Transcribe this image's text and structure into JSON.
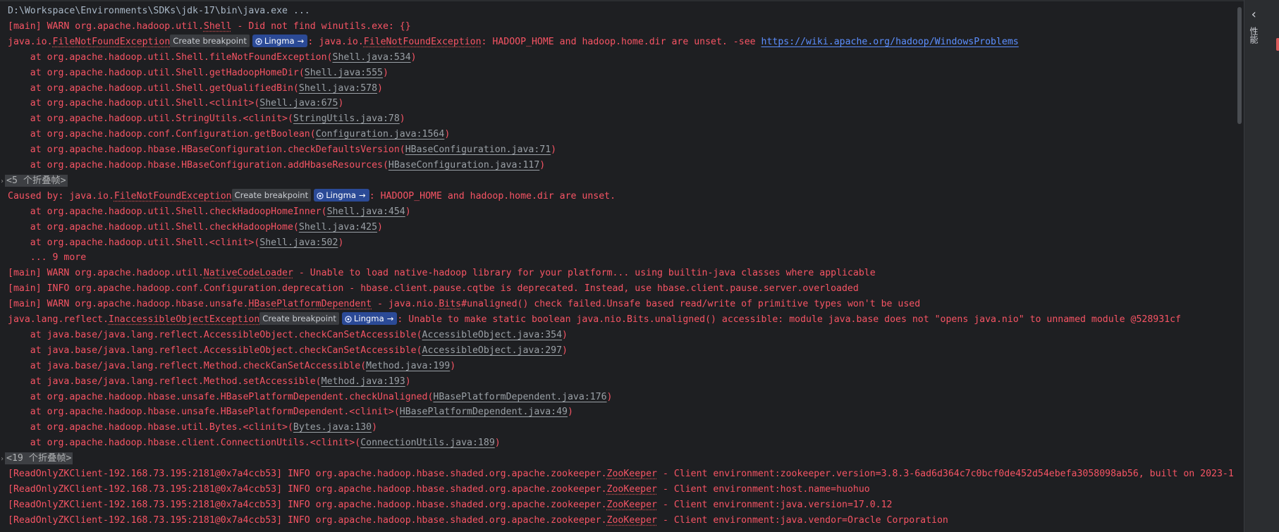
{
  "console": {
    "command": "D:\\Workspace\\Environments\\SDKs\\jdk-17\\bin\\java.exe ...",
    "breakpoint_label": "Create breakpoint",
    "lingma_label": "Lingma",
    "lines": [
      {
        "kind": "cmd"
      },
      {
        "kind": "log",
        "segs": [
          {
            "t": "[main] WARN org.apache.hadoop.util."
          },
          {
            "t": "Shell",
            "s": "u"
          },
          {
            "t": " - Did not find winutils.exe: {}"
          }
        ]
      },
      {
        "kind": "log",
        "segs": [
          {
            "t": "java.io."
          },
          {
            "t": "FileNotFoundException",
            "s": "u"
          },
          {
            "bp": true
          },
          {
            "lg": true
          },
          {
            "t": ": java.io."
          },
          {
            "t": "FileNotFoundException",
            "s": "u"
          },
          {
            "t": ": HADOOP_HOME and hadoop.home.dir are unset. -see "
          },
          {
            "t": "https://wiki.apache.org/hadoop/WindowsProblems",
            "s": "url"
          }
        ]
      },
      {
        "kind": "log",
        "segs": [
          {
            "t": "    at org.apache.hadoop.util.Shell.fileNotFoundException("
          },
          {
            "t": "Shell.java:534",
            "s": "lnk"
          },
          {
            "t": ")"
          }
        ]
      },
      {
        "kind": "log",
        "segs": [
          {
            "t": "    at org.apache.hadoop.util.Shell.getHadoopHomeDir("
          },
          {
            "t": "Shell.java:555",
            "s": "lnk"
          },
          {
            "t": ")"
          }
        ]
      },
      {
        "kind": "log",
        "segs": [
          {
            "t": "    at org.apache.hadoop.util.Shell.getQualifiedBin("
          },
          {
            "t": "Shell.java:578",
            "s": "lnk"
          },
          {
            "t": ")"
          }
        ]
      },
      {
        "kind": "log",
        "segs": [
          {
            "t": "    at org.apache.hadoop.util.Shell.<clinit>("
          },
          {
            "t": "Shell.java:675",
            "s": "lnk"
          },
          {
            "t": ")"
          }
        ]
      },
      {
        "kind": "log",
        "segs": [
          {
            "t": "    at org.apache.hadoop.util.StringUtils.<clinit>("
          },
          {
            "t": "StringUtils.java:78",
            "s": "lnk"
          },
          {
            "t": ")"
          }
        ]
      },
      {
        "kind": "log",
        "segs": [
          {
            "t": "    at org.apache.hadoop.conf.Configuration.getBoolean("
          },
          {
            "t": "Configuration.java:1564",
            "s": "lnk"
          },
          {
            "t": ")"
          }
        ]
      },
      {
        "kind": "log",
        "segs": [
          {
            "t": "    at org.apache.hadoop.hbase.HBaseConfiguration.checkDefaultsVersion("
          },
          {
            "t": "HBaseConfiguration.java:71",
            "s": "lnk"
          },
          {
            "t": ")"
          }
        ]
      },
      {
        "kind": "log",
        "segs": [
          {
            "t": "    at org.apache.hadoop.hbase.HBaseConfiguration.addHbaseResources("
          },
          {
            "t": "HBaseConfiguration.java:117",
            "s": "lnk"
          },
          {
            "t": ")"
          }
        ]
      },
      {
        "kind": "fold",
        "label": "<5 个折叠帧>"
      },
      {
        "kind": "log",
        "segs": [
          {
            "t": "Caused by: java.io."
          },
          {
            "t": "FileNotFoundException",
            "s": "u"
          },
          {
            "bp": true
          },
          {
            "lg": true
          },
          {
            "t": ": HADOOP_HOME and hadoop.home.dir are unset."
          }
        ]
      },
      {
        "kind": "log",
        "segs": [
          {
            "t": "    at org.apache.hadoop.util.Shell.checkHadoopHomeInner("
          },
          {
            "t": "Shell.java:454",
            "s": "lnk"
          },
          {
            "t": ")"
          }
        ]
      },
      {
        "kind": "log",
        "segs": [
          {
            "t": "    at org.apache.hadoop.util.Shell.checkHadoopHome("
          },
          {
            "t": "Shell.java:425",
            "s": "lnk"
          },
          {
            "t": ")"
          }
        ]
      },
      {
        "kind": "log",
        "segs": [
          {
            "t": "    at org.apache.hadoop.util.Shell.<clinit>("
          },
          {
            "t": "Shell.java:502",
            "s": "lnk"
          },
          {
            "t": ")"
          }
        ]
      },
      {
        "kind": "log",
        "segs": [
          {
            "t": "    ... 9 more"
          }
        ]
      },
      {
        "kind": "log",
        "segs": [
          {
            "t": "[main] WARN org.apache.hadoop.util."
          },
          {
            "t": "NativeCodeLoader",
            "s": "u"
          },
          {
            "t": " - Unable to load native-hadoop library for your platform... using builtin-java classes where applicable"
          }
        ]
      },
      {
        "kind": "log",
        "segs": [
          {
            "t": "[main] INFO org.apache.hadoop.conf.Configuration.deprecation - hbase.client.pause.cqtbe is deprecated. Instead, use hbase.client.pause.server.overloaded"
          }
        ]
      },
      {
        "kind": "log",
        "segs": [
          {
            "t": "[main] WARN org.apache.hadoop.hbase.unsafe."
          },
          {
            "t": "HBasePlatformDependent",
            "s": "u"
          },
          {
            "t": " - java.nio."
          },
          {
            "t": "Bits",
            "s": "u"
          },
          {
            "t": "#unaligned() check failed.Unsafe based read/write of primitive types won't be used"
          }
        ]
      },
      {
        "kind": "log",
        "segs": [
          {
            "t": "java.lang.reflect."
          },
          {
            "t": "InaccessibleObjectException",
            "s": "u"
          },
          {
            "bp": true
          },
          {
            "lg": true
          },
          {
            "t": ": Unable to make static boolean java.nio.Bits.unaligned() accessible: module java.base does not \"opens java.nio\" to unnamed module @528931cf"
          }
        ]
      },
      {
        "kind": "log",
        "segs": [
          {
            "t": "    at java.base/java.lang.reflect.AccessibleObject.checkCanSetAccessible("
          },
          {
            "t": "AccessibleObject.java:354",
            "s": "lnk"
          },
          {
            "t": ")"
          }
        ]
      },
      {
        "kind": "log",
        "segs": [
          {
            "t": "    at java.base/java.lang.reflect.AccessibleObject.checkCanSetAccessible("
          },
          {
            "t": "AccessibleObject.java:297",
            "s": "lnk"
          },
          {
            "t": ")"
          }
        ]
      },
      {
        "kind": "log",
        "segs": [
          {
            "t": "    at java.base/java.lang.reflect.Method.checkCanSetAccessible("
          },
          {
            "t": "Method.java:199",
            "s": "lnk"
          },
          {
            "t": ")"
          }
        ]
      },
      {
        "kind": "log",
        "segs": [
          {
            "t": "    at java.base/java.lang.reflect.Method.setAccessible("
          },
          {
            "t": "Method.java:193",
            "s": "lnk"
          },
          {
            "t": ")"
          }
        ]
      },
      {
        "kind": "log",
        "segs": [
          {
            "t": "    at org.apache.hadoop.hbase.unsafe.HBasePlatformDependent.checkUnaligned("
          },
          {
            "t": "HBasePlatformDependent.java:176",
            "s": "lnk"
          },
          {
            "t": ")"
          }
        ]
      },
      {
        "kind": "log",
        "segs": [
          {
            "t": "    at org.apache.hadoop.hbase.unsafe.HBasePlatformDependent.<clinit>("
          },
          {
            "t": "HBasePlatformDependent.java:49",
            "s": "lnk"
          },
          {
            "t": ")"
          }
        ]
      },
      {
        "kind": "log",
        "segs": [
          {
            "t": "    at org.apache.hadoop.hbase.util.Bytes.<clinit>("
          },
          {
            "t": "Bytes.java:130",
            "s": "lnk"
          },
          {
            "t": ")"
          }
        ]
      },
      {
        "kind": "log",
        "segs": [
          {
            "t": "    at org.apache.hadoop.hbase.client.ConnectionUtils.<clinit>("
          },
          {
            "t": "ConnectionUtils.java:189",
            "s": "lnk"
          },
          {
            "t": ")"
          }
        ]
      },
      {
        "kind": "fold",
        "label": "<19 个折叠帧>"
      },
      {
        "kind": "log",
        "segs": [
          {
            "t": "[ReadOnlyZKClient-192.168.73.195:2181@0x7a4ccb53] INFO org.apache.hadoop.hbase.shaded.org.apache.zookeeper."
          },
          {
            "t": "ZooKeeper",
            "s": "u"
          },
          {
            "t": " - Client environment:zookeeper.version=3.8.3-6ad6d364c7c0bcf0de452d54ebefa3058098ab56, built on 2023-1"
          }
        ]
      },
      {
        "kind": "log",
        "segs": [
          {
            "t": "[ReadOnlyZKClient-192.168.73.195:2181@0x7a4ccb53] INFO org.apache.hadoop.hbase.shaded.org.apache.zookeeper."
          },
          {
            "t": "ZooKeeper",
            "s": "u"
          },
          {
            "t": " - Client environment:host.name=huohuo"
          }
        ]
      },
      {
        "kind": "log",
        "segs": [
          {
            "t": "[ReadOnlyZKClient-192.168.73.195:2181@0x7a4ccb53] INFO org.apache.hadoop.hbase.shaded.org.apache.zookeeper."
          },
          {
            "t": "ZooKeeper",
            "s": "u"
          },
          {
            "t": " - Client environment:java.version=17.0.12"
          }
        ]
      },
      {
        "kind": "log",
        "segs": [
          {
            "t": "[ReadOnlyZKClient-192.168.73.195:2181@0x7a4ccb53] INFO org.apache.hadoop.hbase.shaded.org.apache.zookeeper."
          },
          {
            "t": "ZooKeeper",
            "s": "u"
          },
          {
            "t": " - Client environment:java.vendor=Oracle Corporation"
          }
        ]
      }
    ]
  },
  "side_panel": {
    "label": "性能",
    "collapse_icon": "chevron-left-icon"
  },
  "colors": {
    "background": "#1e1f22",
    "error_text": "#f75464",
    "link_blue": "#5c8fff",
    "lingma_badge": "#2b4a96"
  }
}
